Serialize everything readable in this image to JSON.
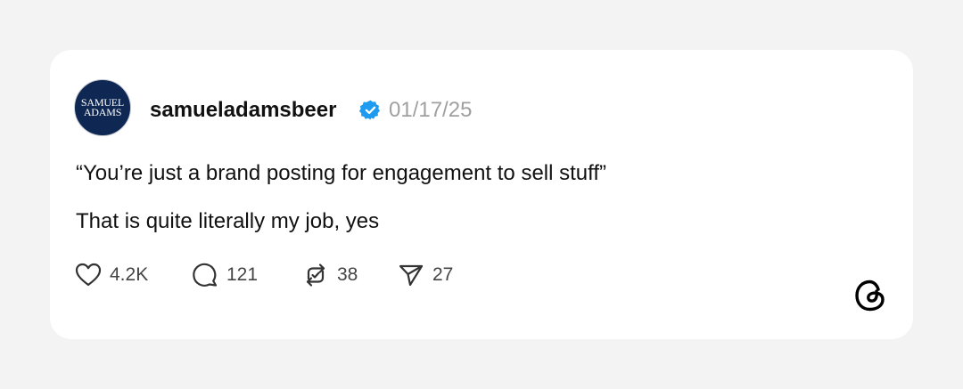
{
  "post": {
    "avatar": {
      "line1": "SAMUEL",
      "line2": "ADAMS",
      "background": "#0e2753"
    },
    "username": "samueladamsbeer",
    "verified_color": "#1d9bf0",
    "date": "01/17/25",
    "text_line1": "“You’re just a brand posting for engagement to sell stuff”",
    "text_line2": "That is quite literally my job, yes"
  },
  "actions": {
    "like": {
      "icon": "heart-icon",
      "count": "4.2K"
    },
    "reply": {
      "icon": "speech-bubble-icon",
      "count": "121"
    },
    "repost": {
      "icon": "repost-icon",
      "count": "38"
    },
    "share": {
      "icon": "paper-plane-icon",
      "count": "27"
    }
  },
  "brand": {
    "icon": "threads-logo-icon"
  }
}
